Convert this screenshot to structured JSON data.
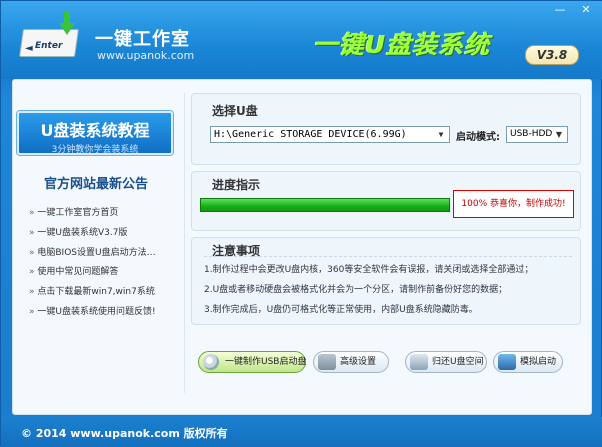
{
  "header": {
    "brand": "一键工作室",
    "url": "www.upanok.com",
    "logo_text": "Enter",
    "title": "一键U盘装系统",
    "version": "V3.8",
    "minimize": "—",
    "close": "✕"
  },
  "sidebar": {
    "tutorial_title": "U盘装系统教程",
    "tutorial_sub": "3分钟教你学会装系统",
    "notice_title": "官方网站最新公告",
    "notices": [
      "一键工作室官方首页",
      "一键U盘装系统V3.7版",
      "电脑BIOS设置U盘启动方法…",
      "使用中常见问题解答",
      "点击下载最新win7,win7系统",
      "一键U盘装系统使用问题反馈!"
    ]
  },
  "usb_panel": {
    "title": "选择U盘",
    "device": "H:\\Generic STORAGE DEVICE(6.99G)",
    "mode_label": "启动模式:",
    "mode": "USB-HDD"
  },
  "progress_panel": {
    "title": "进度指示",
    "progress": 1.0,
    "message": "100%  恭喜你，制作成功!"
  },
  "notes_panel": {
    "title": "注意事项",
    "items": [
      "1.制作过程中会更改U盘内核，360等安全软件会有误报，请关闭或选择全部通过；",
      "2.U盘或者移动硬盘会被格式化并会为一个分区，请制作前备份好您的数据；",
      "3.制作完成后，U盘仍可格式化等正常使用，内部U盘系统隐藏防毒。"
    ]
  },
  "buttons": {
    "make": "一键制作USB启动盘",
    "advanced": "高级设置",
    "restore": "归还U盘空间",
    "simulate": "模拟启动"
  },
  "footer": {
    "text": "© 2014 www.upanok.com  版权所有"
  },
  "colors": {
    "accent": "#1a86d6",
    "title_green": "#9dff3a",
    "progress_green": "#17b017",
    "success_red": "#c40000"
  }
}
